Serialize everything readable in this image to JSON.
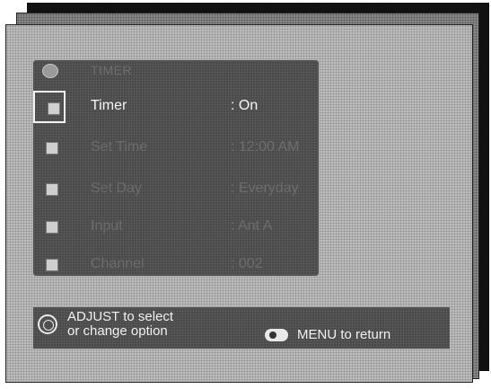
{
  "menu": {
    "title": "TIMER",
    "title_icon": "timer-icon",
    "rows": [
      {
        "label": "Timer",
        "value": ": On",
        "selected": true
      },
      {
        "label": "Set Time",
        "value": ": 12:00 AM",
        "selected": false
      },
      {
        "label": "Set Day",
        "value": ": Everyday",
        "selected": false
      },
      {
        "label": "Input",
        "value": ": Ant A",
        "selected": false
      },
      {
        "label": "Channel",
        "value": ": 002",
        "selected": false
      }
    ]
  },
  "help": {
    "adjust_line1": "ADJUST  to select",
    "adjust_line2": "or change option",
    "menu_return": "MENU to return"
  }
}
